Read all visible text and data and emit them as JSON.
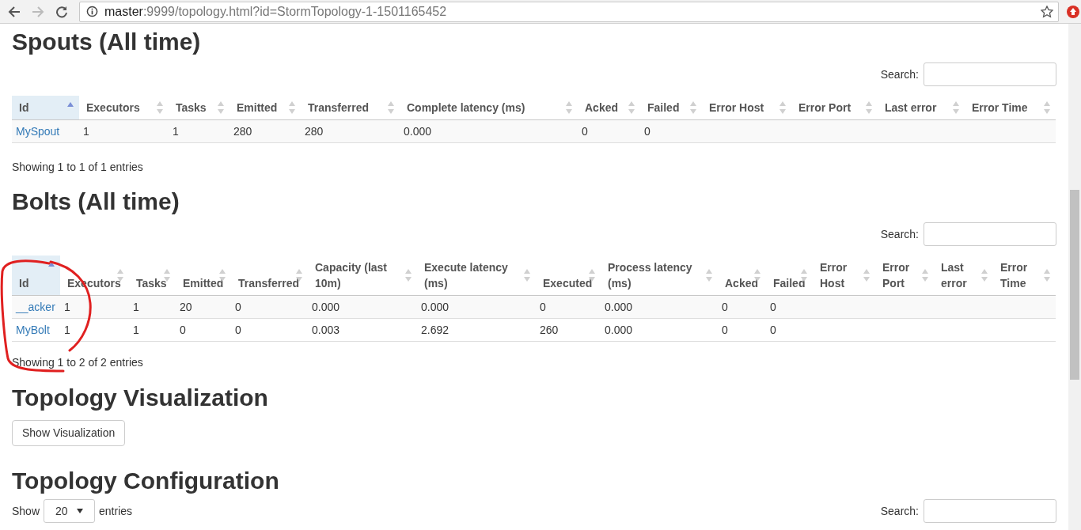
{
  "browser": {
    "url_host": "master",
    "url_rest": ":9999/topology.html?id=StormTopology-1-1501165452"
  },
  "sections": [
    {
      "kind": "table",
      "title": "Spouts (All time)",
      "search_label": "Search:",
      "columns": [
        {
          "label": "Id",
          "sorted": true
        },
        {
          "label": "Executors",
          "sorted": false
        },
        {
          "label": "Tasks",
          "sorted": false
        },
        {
          "label": "Emitted",
          "sorted": false
        },
        {
          "label": "Transferred",
          "sorted": false
        },
        {
          "label": "Complete latency (ms)",
          "sorted": false
        },
        {
          "label": "Acked",
          "sorted": false
        },
        {
          "label": "Failed",
          "sorted": false
        },
        {
          "label": "Error Host",
          "sorted": false
        },
        {
          "label": "Error Port",
          "sorted": false
        },
        {
          "label": "Last error",
          "sorted": false
        },
        {
          "label": "Error Time",
          "sorted": false
        }
      ],
      "rows": [
        {
          "cells": [
            "MySpout",
            "1",
            "1",
            "280",
            "280",
            "0.000",
            "0",
            "0"
          ]
        }
      ],
      "info": "Showing 1 to 1 of 1 entries"
    },
    {
      "kind": "table",
      "title": "Bolts (All time)",
      "search_label": "Search:",
      "columns": [
        {
          "label": "Id",
          "sorted": true
        },
        {
          "label": "Executors",
          "sorted": false
        },
        {
          "label": "Tasks",
          "sorted": false
        },
        {
          "label": "Emitted",
          "sorted": false
        },
        {
          "label": "Transferred",
          "sorted": false
        },
        {
          "label": "Capacity (last 10m)",
          "sorted": false
        },
        {
          "label": "Execute latency (ms)",
          "sorted": false
        },
        {
          "label": "Executed",
          "sorted": false
        },
        {
          "label": "Process latency (ms)",
          "sorted": false
        },
        {
          "label": "Acked",
          "sorted": false
        },
        {
          "label": "Failed",
          "sorted": false
        },
        {
          "label": "Error Host",
          "sorted": false
        },
        {
          "label": "Error Port",
          "sorted": false
        },
        {
          "label": "Last error",
          "sorted": false
        },
        {
          "label": "Error Time",
          "sorted": false
        }
      ],
      "rows": [
        {
          "cells": [
            "__acker",
            "1",
            "1",
            "20",
            "0",
            "0.000",
            "0.000",
            "0",
            "0.000",
            "0",
            "0"
          ]
        },
        {
          "cells": [
            "MyBolt",
            "1",
            "1",
            "0",
            "0",
            "0.003",
            "2.692",
            "260",
            "0.000",
            "0",
            "0"
          ]
        }
      ],
      "info": "Showing 1 to 2 of 2 entries"
    },
    {
      "kind": "button",
      "title": "Topology Visualization",
      "button": "Show Visualization"
    },
    {
      "kind": "config",
      "title": "Topology Configuration",
      "show_label": "Show",
      "page_size": "20",
      "entries_label": "entries",
      "search_label": "Search:"
    }
  ]
}
